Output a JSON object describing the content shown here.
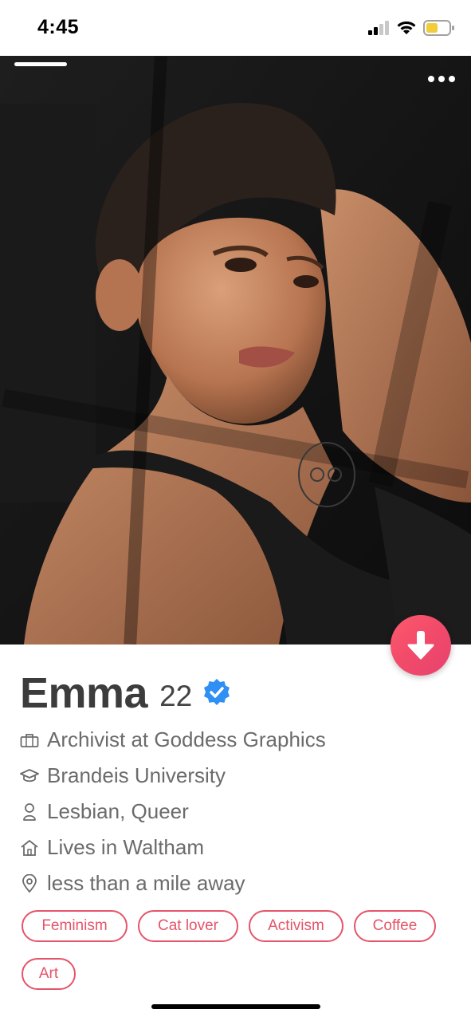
{
  "status_bar": {
    "time": "4:45"
  },
  "profile": {
    "name": "Emma",
    "age": "22",
    "job": "Archivist at Goddess Graphics",
    "school": "Brandeis University",
    "orientation": "Lesbian, Queer",
    "residence": "Lives in Waltham",
    "distance": "less than a mile away",
    "passions": [
      "Feminism",
      "Cat lover",
      "Activism",
      "Coffee",
      "Art"
    ]
  },
  "colors": {
    "accent": "#e5546a",
    "verified": "#2f8ff5",
    "down_button": "#f14a6a"
  },
  "icons": {
    "job": "briefcase-icon",
    "school": "graduation-cap-icon",
    "orientation": "person-icon",
    "residence": "home-icon",
    "distance": "location-pin-icon"
  }
}
